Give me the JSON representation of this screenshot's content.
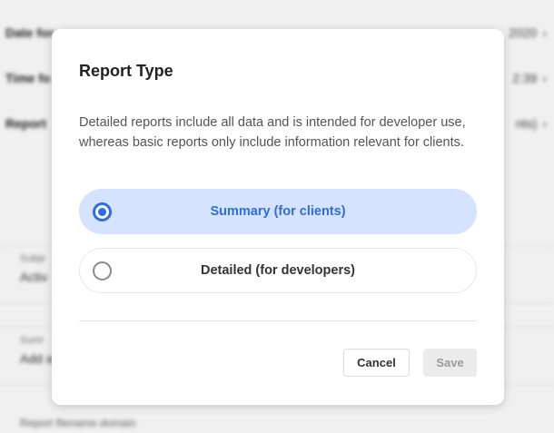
{
  "background": {
    "rows": [
      {
        "label": "Date for",
        "value": "2020"
      },
      {
        "label": "Time fo",
        "value": "2:39"
      },
      {
        "label": "Report",
        "value": "nts)"
      }
    ],
    "fields": [
      {
        "label": "Subje",
        "value": "Activ"
      },
      {
        "label": "Sumr",
        "value": "Add a"
      }
    ],
    "footer": "Report filename domain"
  },
  "modal": {
    "title": "Report Type",
    "description": "Detailed reports include all data and is intended for developer use, whereas basic reports only include information relevant for clients.",
    "options": [
      {
        "label": "Summary (for clients)",
        "selected": true
      },
      {
        "label": "Detailed (for developers)",
        "selected": false
      }
    ],
    "cancel_label": "Cancel",
    "save_label": "Save"
  },
  "colors": {
    "accent": "#2f6de0",
    "selected_bg": "#d5e3ff"
  }
}
